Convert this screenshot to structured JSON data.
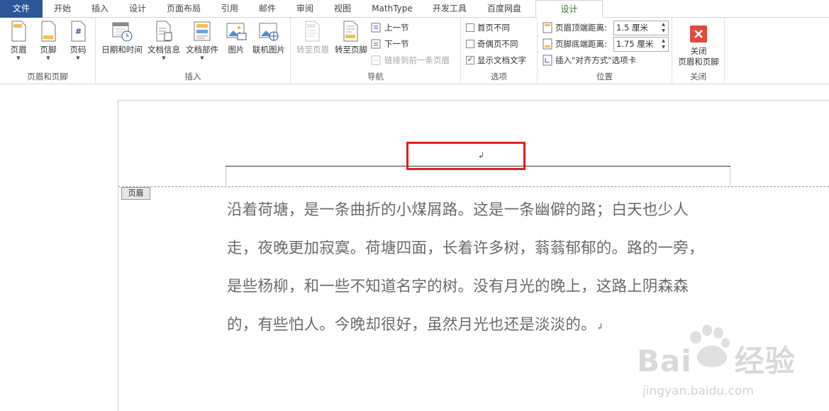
{
  "tabs": [
    {
      "label": "文件"
    },
    {
      "label": "开始"
    },
    {
      "label": "插入"
    },
    {
      "label": "设计"
    },
    {
      "label": "页面布局"
    },
    {
      "label": "引用"
    },
    {
      "label": "邮件"
    },
    {
      "label": "审阅"
    },
    {
      "label": "视图"
    },
    {
      "label": "MathType"
    },
    {
      "label": "开发工具"
    },
    {
      "label": "百度网盘"
    },
    {
      "label": "设计"
    }
  ],
  "groups": {
    "header_footer": {
      "label": "页眉和页脚",
      "header": "页眉",
      "footer": "页脚",
      "page_number": "页码"
    },
    "insert": {
      "label": "插入",
      "datetime": "日期和时间",
      "docinfo": "文档信息",
      "docparts": "文档部件",
      "picture": "图片",
      "online_picture": "联机图片"
    },
    "navigation": {
      "label": "导航",
      "goto_header": "转至页眉",
      "goto_footer": "转至页脚",
      "prev_section": "上一节",
      "next_section": "下一节",
      "link_previous": "链接到前一条页眉"
    },
    "options": {
      "label": "选项",
      "different_first": "首页不同",
      "different_odd_even": "奇偶页不同",
      "show_doc_text": "显示文档文字",
      "show_doc_text_checked": "✓"
    },
    "position": {
      "label": "位置",
      "header_top": "页眉顶端距离:",
      "header_top_value": "1.5 厘米",
      "footer_bottom": "页脚底端距离:",
      "footer_bottom_value": "1.75 厘米",
      "insert_align_tab": "插入\"对齐方式\"选项卡"
    },
    "close": {
      "label": "关闭",
      "close_line1": "关闭",
      "close_line2": "页眉和页脚"
    }
  },
  "document": {
    "header_tag": "页眉",
    "header_cursor": "↲",
    "paragraph": [
      "沿着荷塘，是一条曲折的小煤屑路。这是一条幽僻的路；白天也少人",
      "走，夜晚更加寂寞。荷塘四面，长着许多树，蓊蓊郁郁的。路的一旁，",
      "是些杨柳，和一些不知道名字的树。没有月光的晚上，这路上阴森森",
      "的，有些怕人。今晚却很好，虽然月光也还是淡淡的。"
    ],
    "para_mark": "↲"
  },
  "watermark": {
    "brand": "Bai",
    "brand2": "经验",
    "url": "jingyan.baidu.com"
  },
  "colors": {
    "file_tab": "#2b579a",
    "active_tab_text": "#2b7a2b",
    "highlight": "#e0201f",
    "close_icon": "#e04a3a"
  }
}
